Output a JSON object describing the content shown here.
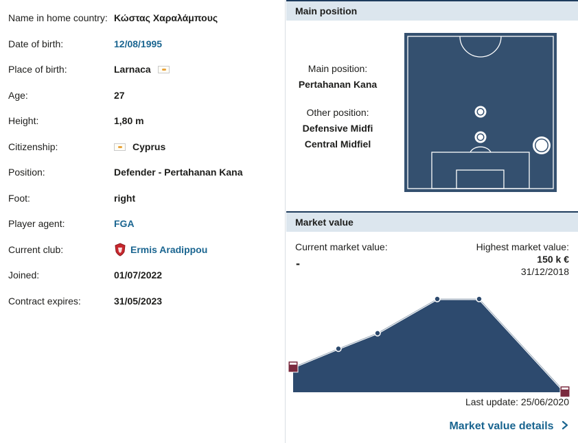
{
  "profile": {
    "rows": [
      {
        "key": "Name in home country:",
        "value": "Κώστας Χαραλάμπους"
      },
      {
        "key": "Date of birth:",
        "value": "12/08/1995"
      },
      {
        "key": "Place of birth:",
        "value": "Larnaca"
      },
      {
        "key": "Age:",
        "value": "27"
      },
      {
        "key": "Height:",
        "value": "1,80 m"
      },
      {
        "key": "Citizenship:",
        "value": "Cyprus"
      },
      {
        "key": "Position:",
        "value": "Defender - Pertahanan Kana"
      },
      {
        "key": "Foot:",
        "value": "right"
      },
      {
        "key": "Player agent:",
        "value": "FGA"
      },
      {
        "key": "Current club:",
        "value": "Ermis Aradippou"
      },
      {
        "key": "Joined:",
        "value": "01/07/2022"
      },
      {
        "key": "Contract expires:",
        "value": "31/05/2023"
      }
    ]
  },
  "main_position": {
    "header": "Main position",
    "main_label": "Main position:",
    "main_value": "Pertahanan Kana",
    "other_label": "Other position:",
    "other_values": [
      "Defensive Midfi",
      "Central Midfiel"
    ]
  },
  "market_value": {
    "header": "Market value",
    "current_label": "Current market value:",
    "current_value": "-",
    "highest_label": "Highest market value:",
    "highest_value": "150 k €",
    "highest_date": "31/12/2018",
    "last_update": "Last update: 25/06/2020",
    "details_link": "Market value details",
    "details_icon": "chevron-right-icon"
  },
  "chart_data": {
    "type": "area",
    "values": [
      40,
      70,
      95,
      150,
      150,
      0
    ],
    "ylim": [
      0,
      150
    ]
  },
  "colors": {
    "link": "#1a6590",
    "header_bg": "#dce6ee",
    "pitch": "#34506f",
    "chart_fill": "#2d4a6e"
  }
}
